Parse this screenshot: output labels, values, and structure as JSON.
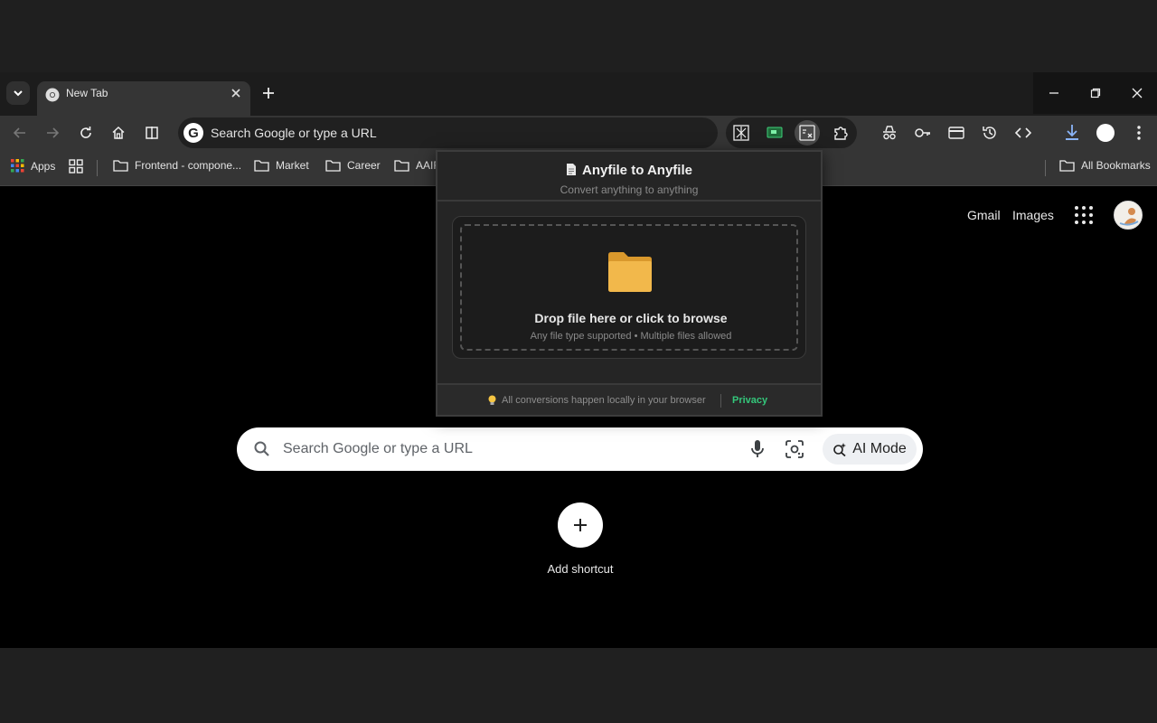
{
  "browser": {
    "tab_title": "New Tab",
    "omnibox_placeholder": "Search Google or type a URL"
  },
  "bookmarks": [
    {
      "label": "Apps"
    },
    {
      "label": "Frontend - compone..."
    },
    {
      "label": "Market"
    },
    {
      "label": "Career"
    },
    {
      "label": "AAIF"
    },
    {
      "label": "All Bookmarks"
    }
  ],
  "page": {
    "links": [
      "Gmail",
      "Images"
    ],
    "search_placeholder": "Search Google or type a URL",
    "ai_mode_label": "AI Mode",
    "add_shortcut_label": "Add shortcut"
  },
  "popup": {
    "title": "Anyfile to Anyfile",
    "subtitle": "Convert anything to anything",
    "drop_title": "Drop file here or click to browse",
    "drop_subtitle": "Any file type supported • Multiple files allowed",
    "footer_text": "All conversions happen locally in your browser",
    "privacy_label": "Privacy"
  },
  "colors": {
    "accent_green": "#34c77b",
    "folder_yellow": "#f2b84b"
  }
}
